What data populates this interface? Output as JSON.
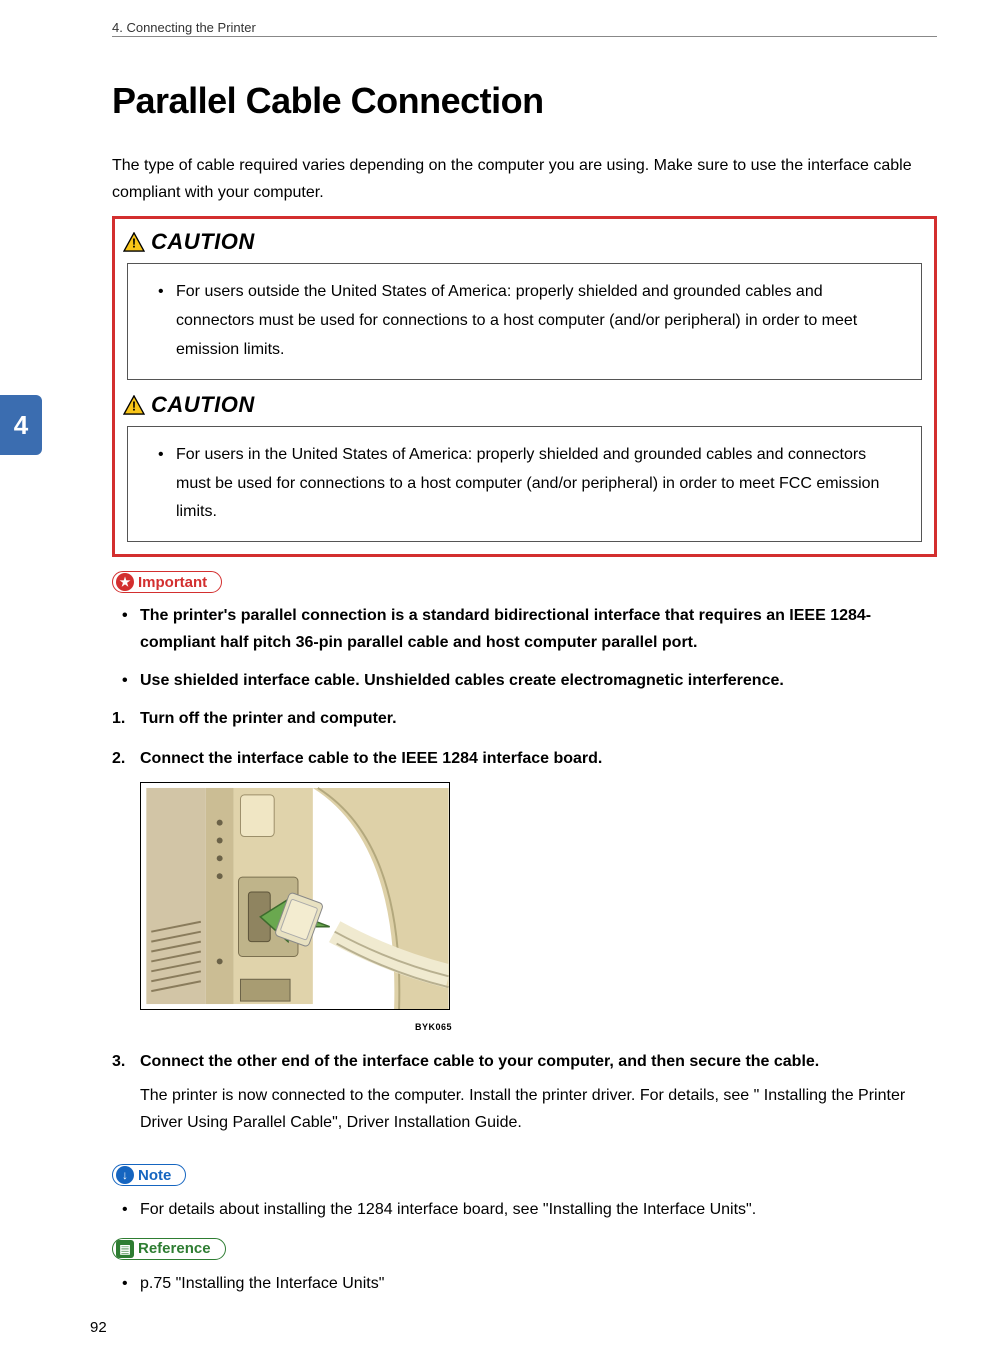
{
  "header": {
    "chapter_line": "4. Connecting the Printer",
    "chapter_number": "4"
  },
  "title": "Parallel Cable Connection",
  "intro": "The type of cable required varies depending on the computer you are using. Make sure to use the interface cable compliant with your computer.",
  "caution_label": "CAUTION",
  "caution1": "For users outside the United States of America: properly shielded and grounded cables and connectors must be used for connections to a host computer (and/or peripheral) in order to meet emission limits.",
  "caution2": "For users in the United States of America: properly shielded and grounded cables and connectors must be used for connections to a host computer (and/or peripheral) in order to meet FCC emission limits.",
  "important_label": "Important",
  "important_items": [
    "The printer's parallel connection is a standard bidirectional interface that requires an IEEE 1284-compliant half pitch 36-pin parallel cable and host computer parallel port.",
    "Use shielded interface cable. Unshielded cables create electromagnetic interference."
  ],
  "steps": [
    {
      "text": "Turn off the printer and computer."
    },
    {
      "text": "Connect the interface cable to the IEEE 1284 interface board.",
      "has_figure": true
    },
    {
      "text": "Connect the other end of the interface cable to your computer, and then secure the cable.",
      "sub": "The printer is now connected to the computer. Install the printer driver. For details, see \" Installing the Printer Driver Using Parallel Cable\", Driver Installation Guide."
    }
  ],
  "figure_id": "BYK065",
  "note_label": "Note",
  "note_item": "For details about installing the 1284 interface board, see \"Installing the Interface Units\".",
  "reference_label": "Reference",
  "reference_item": "p.75 \"Installing the Interface Units\"",
  "page_number": "92"
}
